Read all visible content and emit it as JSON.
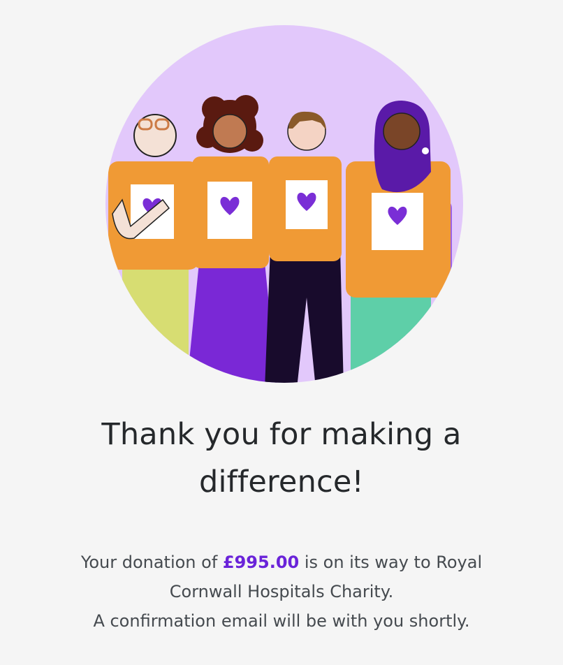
{
  "colors": {
    "background": "#f5f5f5",
    "circle": "#e2c8fb",
    "shirt": "#f09a35",
    "heart": "#7a2ed6",
    "accent": "#6a23d9"
  },
  "illustration": {
    "icon": "volunteers-illustration"
  },
  "heading": {
    "line1": "Thank you for making a",
    "line2": "difference!"
  },
  "confirmation": {
    "prefix": "Your donation of ",
    "amount": "£995.00",
    "suffix": " is on its way to Royal",
    "line2": "Cornwall Hospitals Charity.",
    "line3": "A confirmation email will be with you shortly."
  }
}
